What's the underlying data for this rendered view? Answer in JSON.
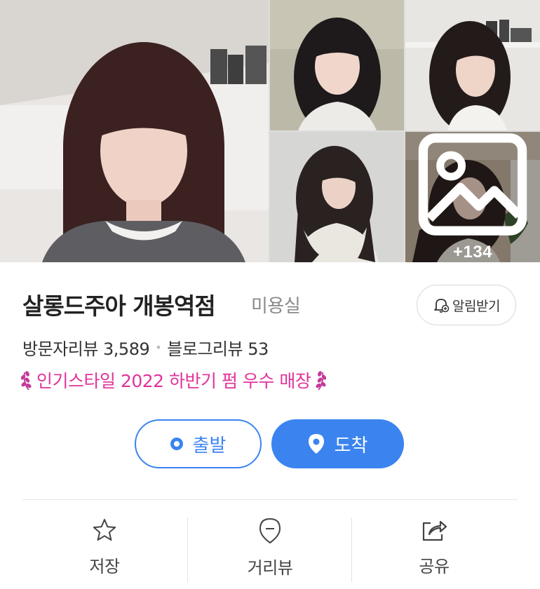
{
  "gallery": {
    "more_count": "+134",
    "more_icon": "image-icon"
  },
  "place": {
    "name": "살롱드주아 개봉역점",
    "category": "미용실",
    "alarm_label": "알림받기",
    "visitor_reviews": "방문자리뷰 3,589",
    "blog_reviews": "블로그리뷰 53",
    "award": "인기스타일 2022 하반기 펌 우수 매장"
  },
  "route": {
    "depart_label": "출발",
    "arrive_label": "도착"
  },
  "actions": {
    "save": "저장",
    "street_view": "거리뷰",
    "share": "공유"
  },
  "colors": {
    "accent_blue": "#3b84f0",
    "award_pink": "#e1339a",
    "text_dark": "#222222",
    "text_gray": "#8a8a8a"
  }
}
